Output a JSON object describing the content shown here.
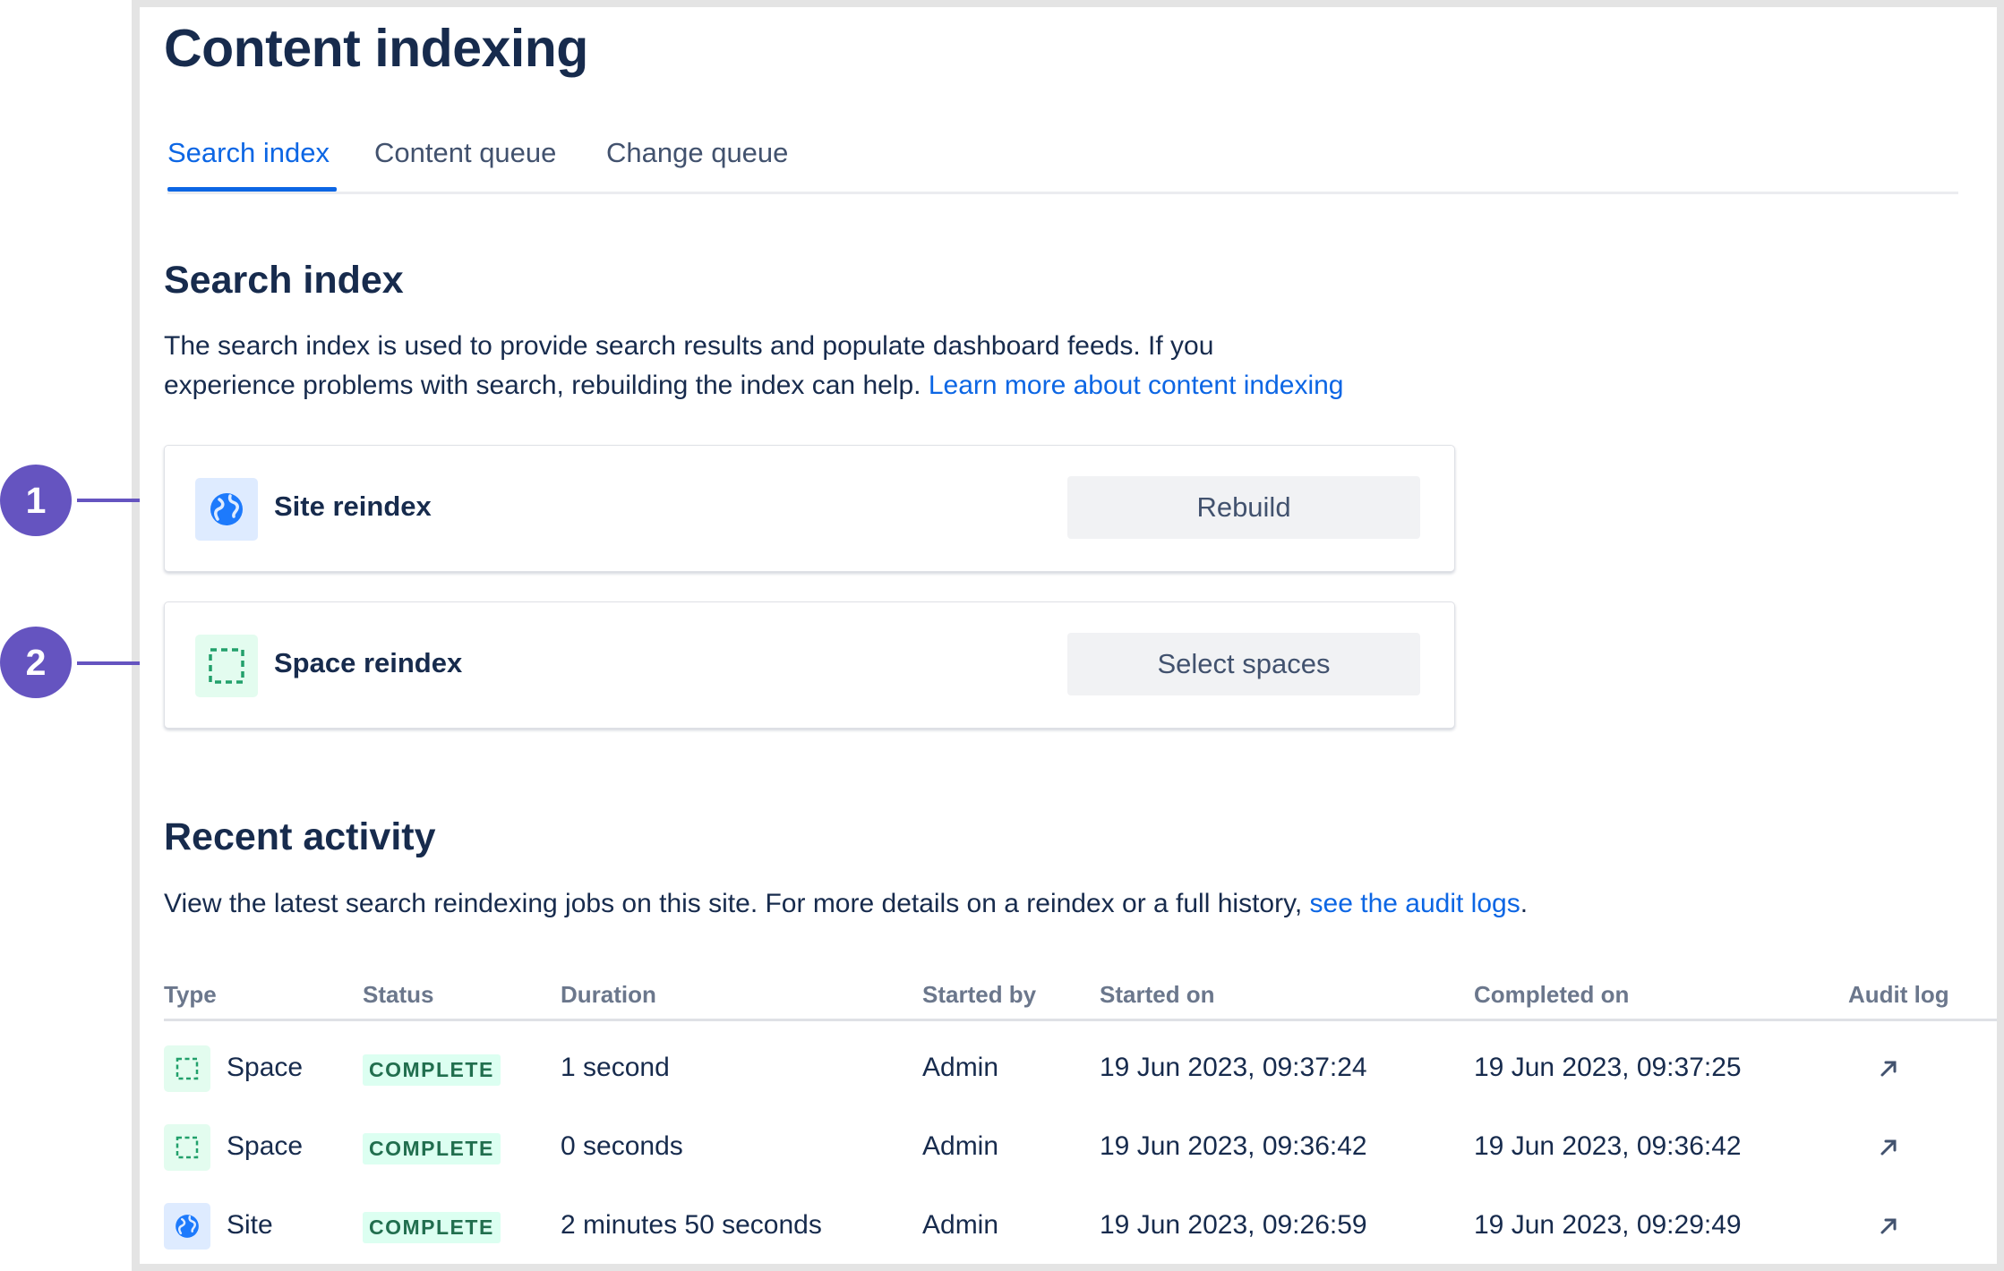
{
  "page": {
    "title": "Content indexing"
  },
  "tabs": [
    {
      "label": "Search index",
      "active": true
    },
    {
      "label": "Content queue",
      "active": false
    },
    {
      "label": "Change queue",
      "active": false
    }
  ],
  "search_index": {
    "title": "Search index",
    "description_line1": "The search index is used to provide search results and populate dashboard feeds. If you",
    "description_line2": "experience problems with search, rebuilding the index can help.",
    "learn_more": "Learn more about content indexing",
    "cards": [
      {
        "label": "Site reindex",
        "button": "Rebuild",
        "icon": "globe-icon",
        "callout": "1"
      },
      {
        "label": "Space reindex",
        "button": "Select spaces",
        "icon": "space-icon",
        "callout": "2"
      }
    ]
  },
  "recent_activity": {
    "title": "Recent activity",
    "description": "View the latest search reindexing jobs on this site. For more details on a reindex or a full history,",
    "audit_link": "see the audit logs",
    "period": ".",
    "columns": [
      "Type",
      "Status",
      "Duration",
      "Started by",
      "Started on",
      "Completed on",
      "Audit log"
    ],
    "rows": [
      {
        "type": "Space",
        "icon": "space-icon",
        "status": "COMPLETE",
        "duration": "1 second",
        "started_by": "Admin",
        "started_on": "19 Jun 2023, 09:37:24",
        "completed_on": "19 Jun 2023, 09:37:25",
        "audit": "arrow-up-right-icon"
      },
      {
        "type": "Space",
        "icon": "space-icon",
        "status": "COMPLETE",
        "duration": "0 seconds",
        "started_by": "Admin",
        "started_on": "19 Jun 2023, 09:36:42",
        "completed_on": "19 Jun 2023, 09:36:42",
        "audit": "arrow-up-right-icon"
      },
      {
        "type": "Site",
        "icon": "globe-icon",
        "status": "COMPLETE",
        "duration": "2 minutes 50 seconds",
        "started_by": "Admin",
        "started_on": "19 Jun 2023, 09:26:59",
        "completed_on": "19 Jun 2023, 09:29:49",
        "audit": "arrow-up-right-icon"
      }
    ]
  },
  "colors": {
    "accent": "#0c66e4",
    "callout": "#6554c0",
    "success_bg": "#dcfff1",
    "success_text": "#216e4e"
  }
}
